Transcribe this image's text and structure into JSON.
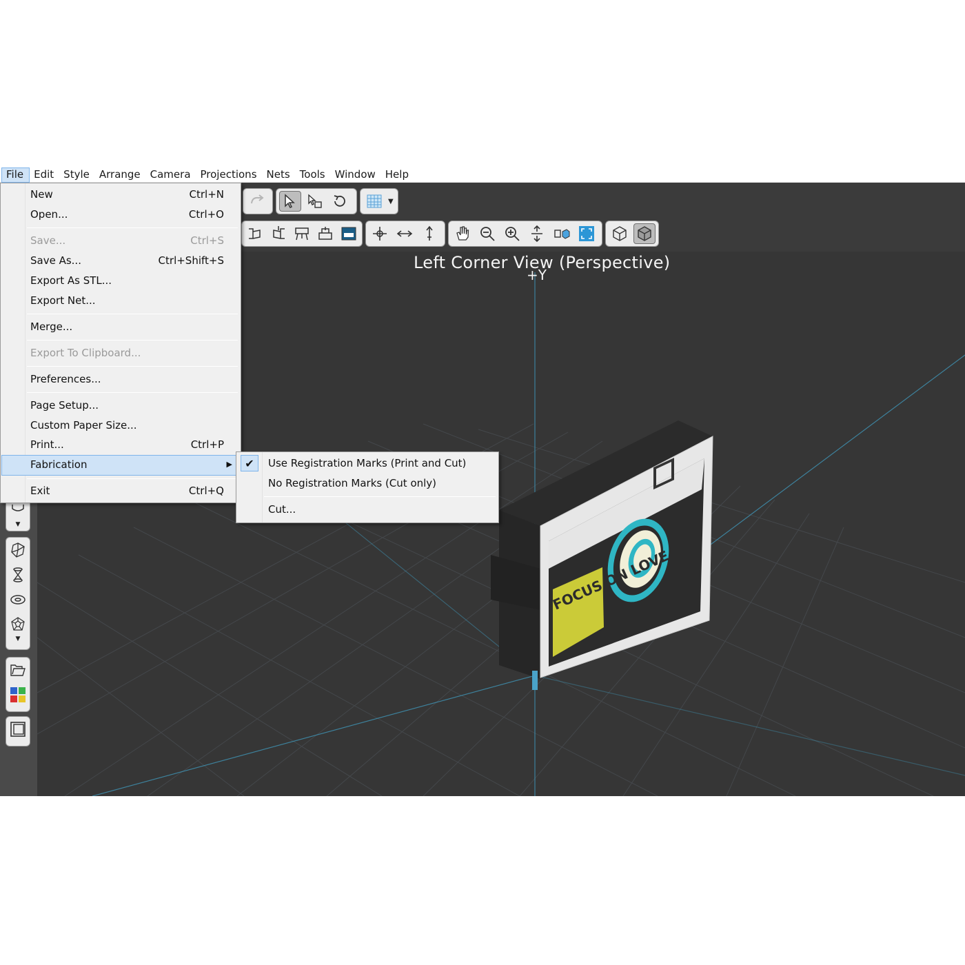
{
  "menubar": {
    "items": [
      "File",
      "Edit",
      "Style",
      "Arrange",
      "Camera",
      "Projections",
      "Nets",
      "Tools",
      "Window",
      "Help"
    ],
    "active": "File"
  },
  "file_menu": {
    "new": {
      "label": "New",
      "shortcut": "Ctrl+N"
    },
    "open": {
      "label": "Open...",
      "shortcut": "Ctrl+O"
    },
    "save": {
      "label": "Save...",
      "shortcut": "Ctrl+S"
    },
    "save_as": {
      "label": "Save As...",
      "shortcut": "Ctrl+Shift+S"
    },
    "export_stl": {
      "label": "Export As STL..."
    },
    "export_net": {
      "label": "Export Net..."
    },
    "merge": {
      "label": "Merge..."
    },
    "export_clipboard": {
      "label": "Export To Clipboard..."
    },
    "preferences": {
      "label": "Preferences..."
    },
    "page_setup": {
      "label": "Page Setup..."
    },
    "custom_paper": {
      "label": "Custom Paper Size..."
    },
    "print": {
      "label": "Print...",
      "shortcut": "Ctrl+P"
    },
    "fabrication": {
      "label": "Fabrication"
    },
    "exit": {
      "label": "Exit",
      "shortcut": "Ctrl+Q"
    }
  },
  "fabrication_submenu": {
    "use_marks": {
      "label": "Use Registration Marks (Print and Cut)",
      "checked": true
    },
    "no_marks": {
      "label": "No Registration Marks (Cut only)"
    },
    "cut": {
      "label": "Cut..."
    }
  },
  "viewport": {
    "title": "Left Corner View (Perspective)",
    "axis_label": "+Y"
  },
  "model": {
    "text": "FOCUS ON LOVE",
    "text_color": "#d9d93a",
    "lens_accent": "#2fb6c4"
  },
  "icons": {
    "toolbar_row1": [
      "redo-icon",
      "select-arrow-icon",
      "select-face-icon",
      "rotate-icon",
      "grid-icon",
      "dropdown-icon"
    ],
    "toolbar_row2": [
      "view-left-icon",
      "view-right-icon",
      "view-front-icon",
      "view-back-icon",
      "view-top-icon",
      "move-icon",
      "translate-icon",
      "hand-icon",
      "pan-icon",
      "zoom-out-icon",
      "zoom-in-icon",
      "zoom-fit-icon",
      "camera-orbit-icon",
      "frame-icon",
      "cube-wire-icon",
      "cube-solid-icon"
    ],
    "left_tools": [
      "cylinder-icon",
      "dropdown-icon",
      "polyhedron-icon",
      "hourglass-icon",
      "torus-icon",
      "dodecahedron-icon",
      "dropdown-icon",
      "folder-icon",
      "color-palette-icon",
      "panel-icon"
    ]
  }
}
